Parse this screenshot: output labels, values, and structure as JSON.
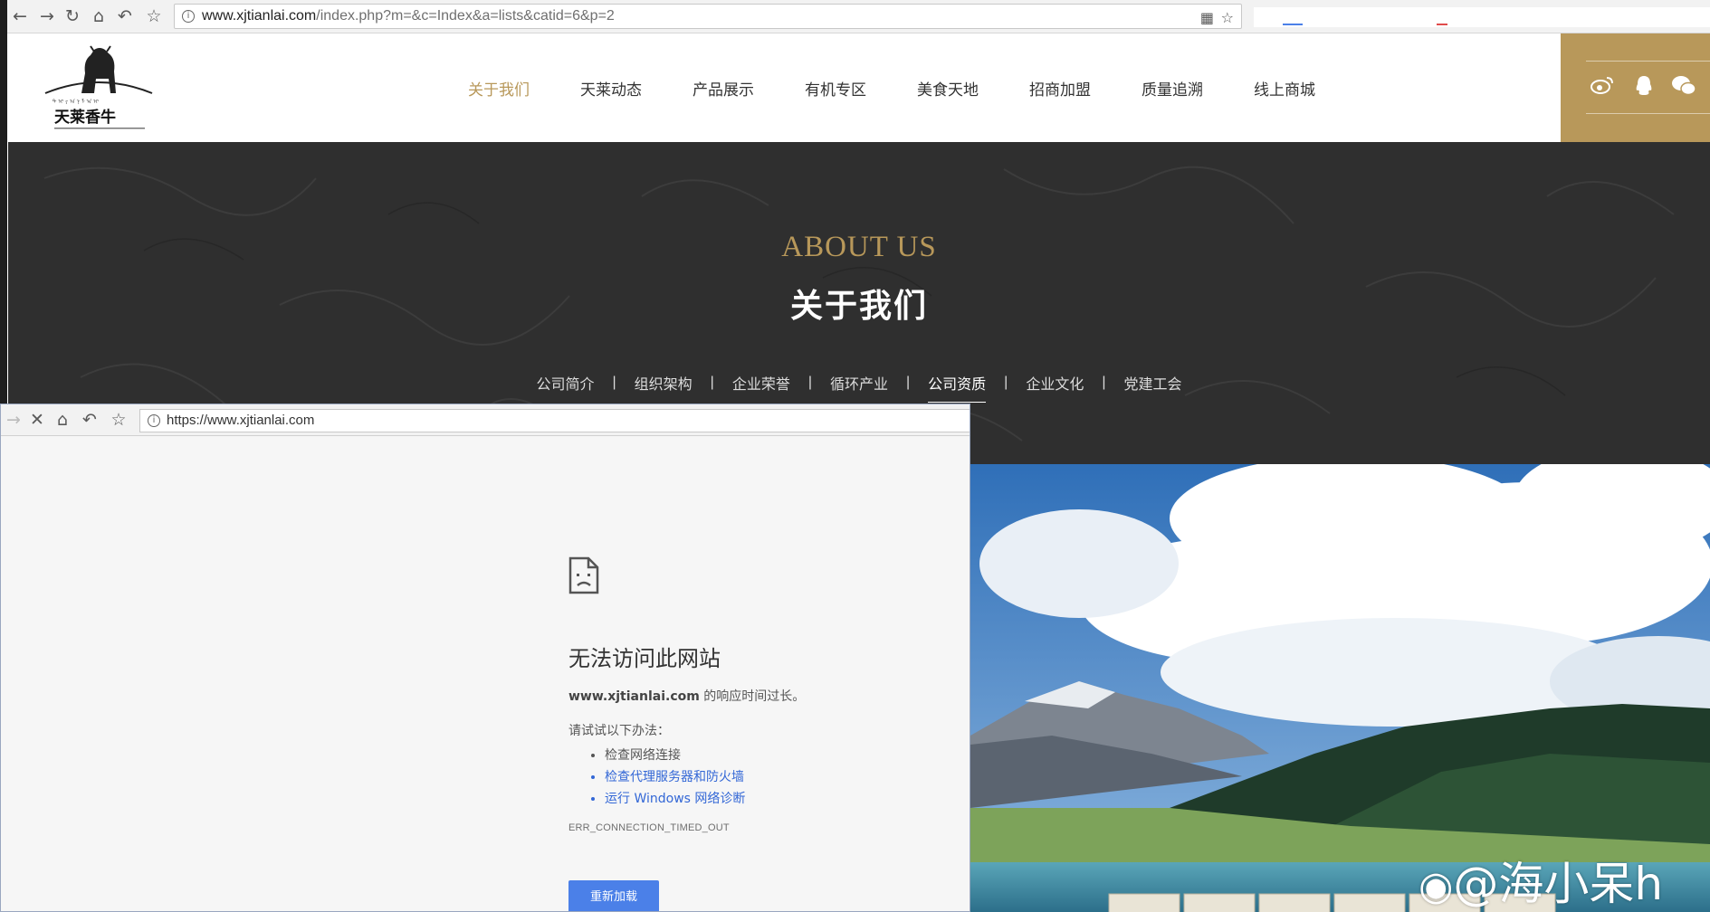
{
  "browser_main": {
    "url_host": "www.xjtianlai.com",
    "url_path": "/index.php?m=&c=Index&a=lists&catid=6&p=2",
    "icons": [
      "back-icon",
      "forward-icon",
      "reload-icon",
      "home-icon",
      "undo-icon",
      "star-icon",
      "info-icon",
      "qr-code-icon"
    ]
  },
  "header": {
    "nav": [
      {
        "label": "关于我们",
        "active": true
      },
      {
        "label": "天莱动态"
      },
      {
        "label": "产品展示"
      },
      {
        "label": "有机专区"
      },
      {
        "label": "美食天地"
      },
      {
        "label": "招商加盟"
      },
      {
        "label": "质量追溯"
      },
      {
        "label": "线上商城"
      }
    ],
    "social_icons": [
      "weibo-icon",
      "qq-icon",
      "wechat-icon"
    ]
  },
  "banner": {
    "title_en": "ABOUT US",
    "title_cn": "关于我们",
    "subnav": [
      {
        "label": "公司简介"
      },
      {
        "label": "组织架构"
      },
      {
        "label": "企业荣誉"
      },
      {
        "label": "循环产业"
      },
      {
        "label": "公司资质",
        "active": true
      },
      {
        "label": "企业文化"
      },
      {
        "label": "党建工会"
      }
    ]
  },
  "browser_error": {
    "url": "https://www.xjtianlai.com",
    "title": "无法访问此网站",
    "host": "www.xjtianlai.com",
    "message": " 的响应时间过长。",
    "try_label": "请试试以下办法：",
    "suggestions": [
      "检查网络连接",
      "检查代理服务器和防火墙",
      "运行 Windows 网络诊断"
    ],
    "error_code": "ERR_CONNECTION_TIMED_OUT",
    "reload_label": "重新加载"
  },
  "watermark": "@海小呆h",
  "colors": {
    "accent_gold": "#b8985a",
    "banner_bg": "#2f2f2f",
    "link_blue": "#3367d6",
    "reload_blue": "#4b80e8"
  }
}
